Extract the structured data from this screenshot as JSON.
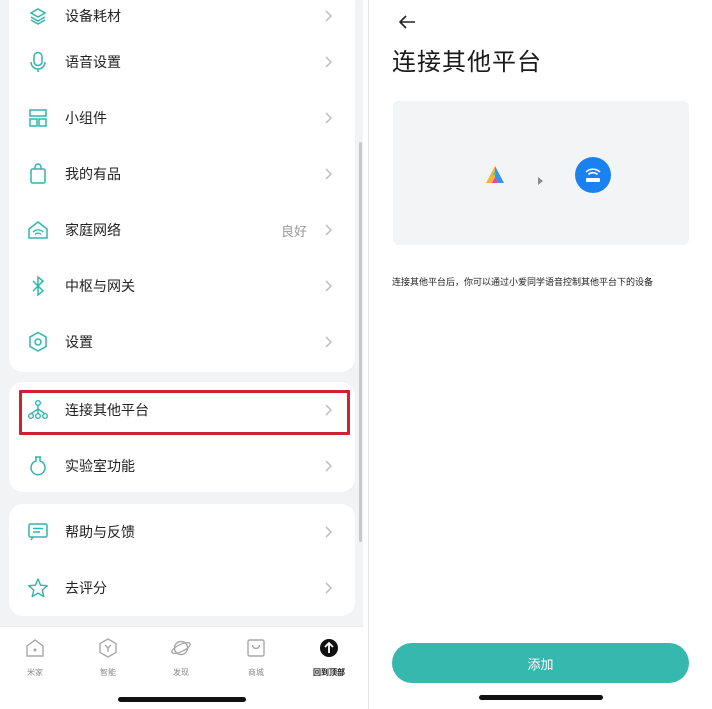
{
  "left": {
    "menu": [
      {
        "label": "设备耗材",
        "icon": "consumables-icon"
      },
      {
        "label": "语音设置",
        "icon": "microphone-icon"
      },
      {
        "label": "小组件",
        "icon": "widget-icon"
      },
      {
        "label": "我的有品",
        "icon": "shopping-bag-icon"
      },
      {
        "label": "家庭网络",
        "icon": "home-wifi-icon",
        "value": "良好"
      },
      {
        "label": "中枢与网关",
        "icon": "bluetooth-icon"
      },
      {
        "label": "设置",
        "icon": "settings-hexagon-icon"
      },
      {
        "label": "连接其他平台",
        "icon": "network-tree-icon"
      },
      {
        "label": "实验室功能",
        "icon": "flask-icon"
      },
      {
        "label": "帮助与反馈",
        "icon": "feedback-icon"
      },
      {
        "label": "去评分",
        "icon": "star-icon"
      }
    ],
    "tabs": [
      {
        "label": "米家",
        "icon": "home-tab-icon"
      },
      {
        "label": "智能",
        "icon": "smart-tab-icon"
      },
      {
        "label": "发现",
        "icon": "planet-tab-icon"
      },
      {
        "label": "商城",
        "icon": "store-tab-icon"
      },
      {
        "label": "回到顶部",
        "icon": "arrow-up-circle-icon"
      }
    ],
    "highlight_color": "#d0212e",
    "accent_color": "#2fb6ad"
  },
  "right": {
    "title": "连接其他平台",
    "description": "连接其他平台后，你可以通过小爱同学语音控制其他平台下的设备",
    "add_button": "添加",
    "button_color": "#37b8ae",
    "platform_badge_color": "#1a82f0"
  }
}
